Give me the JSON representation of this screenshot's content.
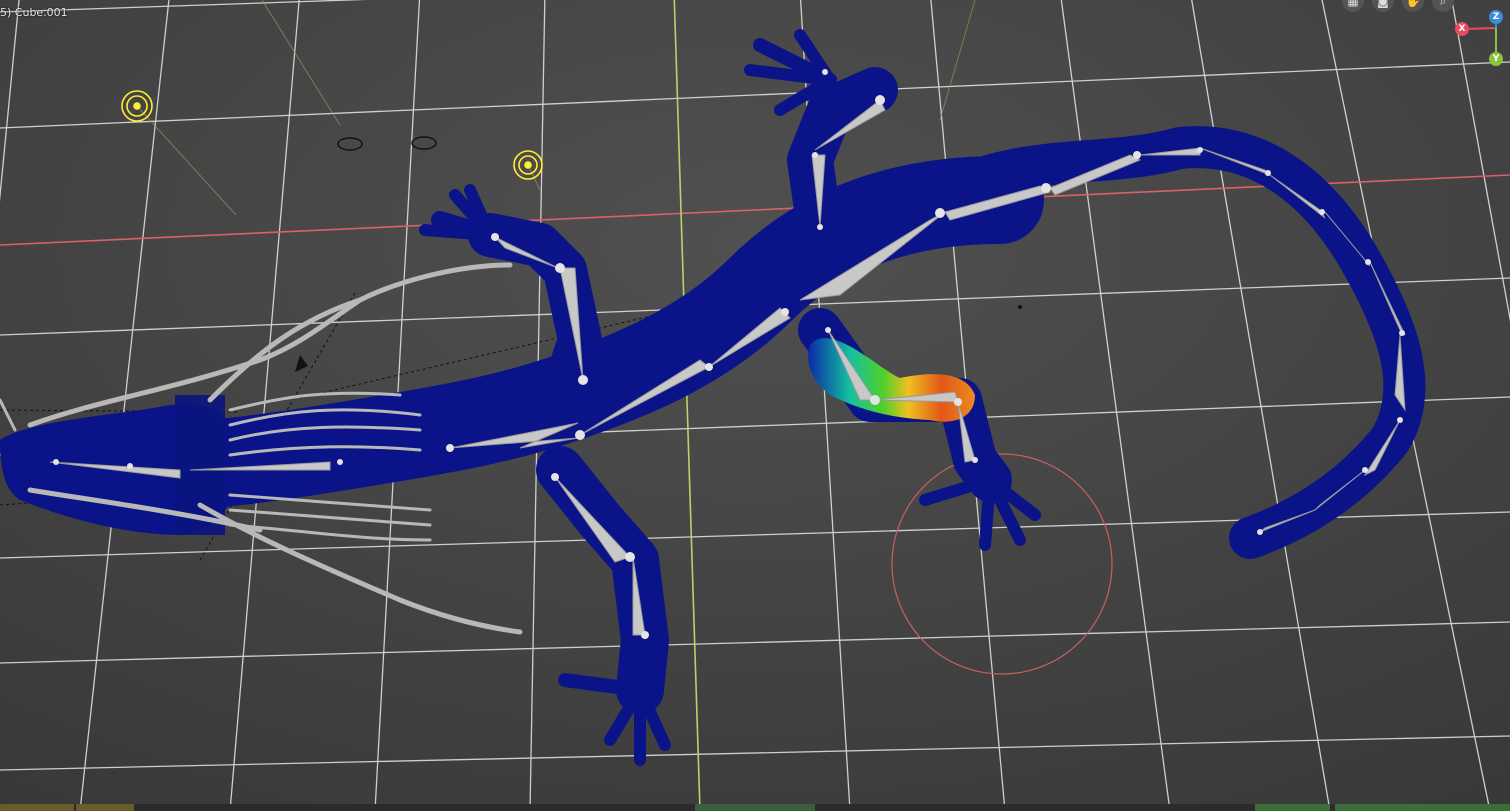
{
  "viewport": {
    "object_label": "5) Cube.001",
    "colors": {
      "background": "#3d3d3d",
      "grid": "#e8e8e8",
      "x_axis": "#d9606c",
      "y_axis": "#b9d26a",
      "mesh": "#0a1488",
      "bone": "#c8c8c8",
      "light": "#ffee33",
      "brush_circle": "#c66060"
    }
  },
  "nav_tools": {
    "icons": [
      "grid-view-icon",
      "camera-icon",
      "hand-pan-icon",
      "zoom-icon"
    ]
  },
  "axis_gizmo": {
    "x_label": "X",
    "z_label": "Z",
    "y_label": "Y",
    "x_color": "#e94b5d",
    "y_color": "#8bc33d",
    "z_color": "#3e8bde"
  }
}
